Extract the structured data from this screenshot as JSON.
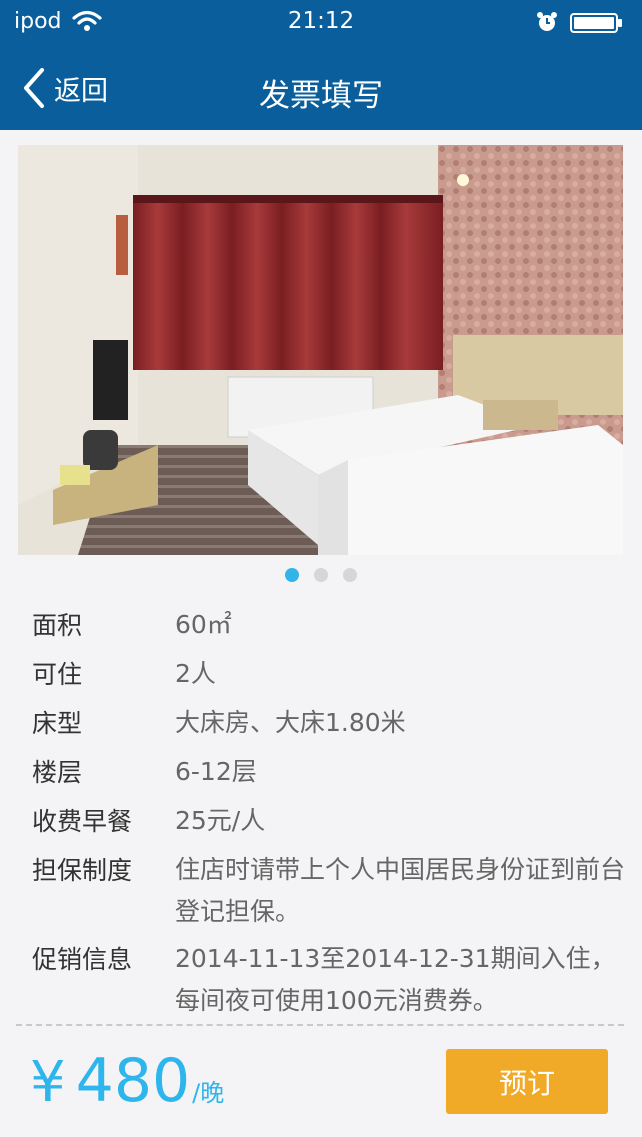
{
  "status": {
    "carrier": "ipod",
    "time": "21:12"
  },
  "nav": {
    "back_label": "返回",
    "title": "发票填写"
  },
  "gallery": {
    "count": 3,
    "active_index": 0
  },
  "details": [
    {
      "label": "面积",
      "value": "60㎡"
    },
    {
      "label": "可住",
      "value": "2人"
    },
    {
      "label": "床型",
      "value": "大床房、大床1.80米"
    },
    {
      "label": "楼层",
      "value": "6-12层"
    },
    {
      "label": "收费早餐",
      "value": "25元/人"
    },
    {
      "label": "担保制度",
      "value": "住店时请带上个人中国居民身份证到前台登记担保。"
    },
    {
      "label": "促销信息",
      "value": "2014-11-13至2014-12-31期间入住，每间夜可使用100元消费券。"
    }
  ],
  "price": {
    "currency": "¥",
    "amount": "480",
    "unit": "/晚"
  },
  "book_button": "预订",
  "colors": {
    "nav_bg": "#0a5e9c",
    "price": "#2eb6ec",
    "button": "#f0aa28",
    "dot_active": "#33b4e8"
  }
}
